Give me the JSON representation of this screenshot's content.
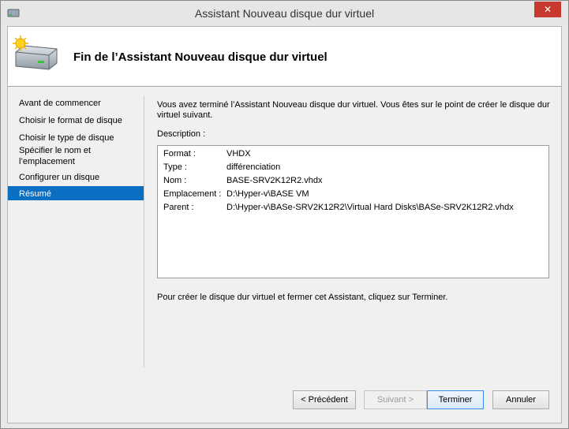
{
  "window": {
    "title": "Assistant Nouveau disque dur virtuel",
    "close_glyph": "✕",
    "icon": "hard-disk-icon"
  },
  "header": {
    "title": "Fin de l’Assistant Nouveau disque dur virtuel",
    "icon": "new-virtual-disk-icon"
  },
  "nav": {
    "items": [
      {
        "label": "Avant de commencer"
      },
      {
        "label": "Choisir le format de disque"
      },
      {
        "label": "Choisir le type de disque"
      },
      {
        "label_line1": "Spécifier le nom et",
        "label_line2": "l’emplacement"
      },
      {
        "label": "Configurer un disque"
      },
      {
        "label": "Résumé",
        "active": true
      }
    ]
  },
  "main": {
    "intro_line1": "Vous avez terminé l’Assistant Nouveau disque dur virtuel. Vous êtes sur le point de créer le disque dur",
    "intro_line2": "virtuel suivant.",
    "description_label": "Description :",
    "description": [
      {
        "key": "Format :",
        "value": "VHDX"
      },
      {
        "key": "Type :",
        "value": "différenciation"
      },
      {
        "key": "Nom :",
        "value": "BASE-SRV2K12R2.vhdx"
      },
      {
        "key": "Emplacement :",
        "value": "D:\\Hyper-v\\BASE VM"
      },
      {
        "key": "Parent :",
        "value": "D:\\Hyper-v\\BASe-SRV2K12R2\\Virtual Hard Disks\\BASe-SRV2K12R2.vhdx"
      }
    ],
    "finish_text": "Pour créer le disque dur virtuel et fermer cet Assistant, cliquez sur Terminer."
  },
  "buttons": {
    "previous": "< Précédent",
    "next": "Suivant >",
    "finish": "Terminer",
    "cancel": "Annuler"
  },
  "colors": {
    "selection": "#0a6fc2",
    "close": "#c7392f"
  }
}
